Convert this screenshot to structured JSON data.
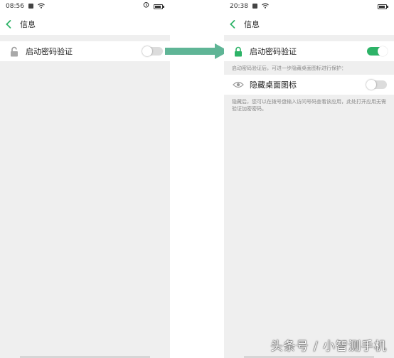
{
  "left_screen": {
    "status": {
      "time": "08:56"
    },
    "title": "信息",
    "rows": [
      {
        "label": "启动密码验证",
        "icon": "unlocked-padlock-icon",
        "toggle_on": false
      }
    ]
  },
  "right_screen": {
    "status": {
      "time": "20:38"
    },
    "title": "信息",
    "rows": [
      {
        "label": "启动密码验证",
        "icon": "locked-padlock-icon",
        "toggle_on": true,
        "hint": "启动密码验证后，可进一步隐藏桌面图标进行保护："
      },
      {
        "label": "隐藏桌面图标",
        "icon": "eye-icon",
        "toggle_on": false,
        "hint": "隐藏后，您可以在拨号盘输入访问号码查看该应用，此处打开应用无需验证加密密码。"
      }
    ]
  },
  "watermark": "头条号 / 小智测手机",
  "colors": {
    "accent_green": "#2db367",
    "arrow_green": "#5fb596",
    "background": "#efefef"
  }
}
